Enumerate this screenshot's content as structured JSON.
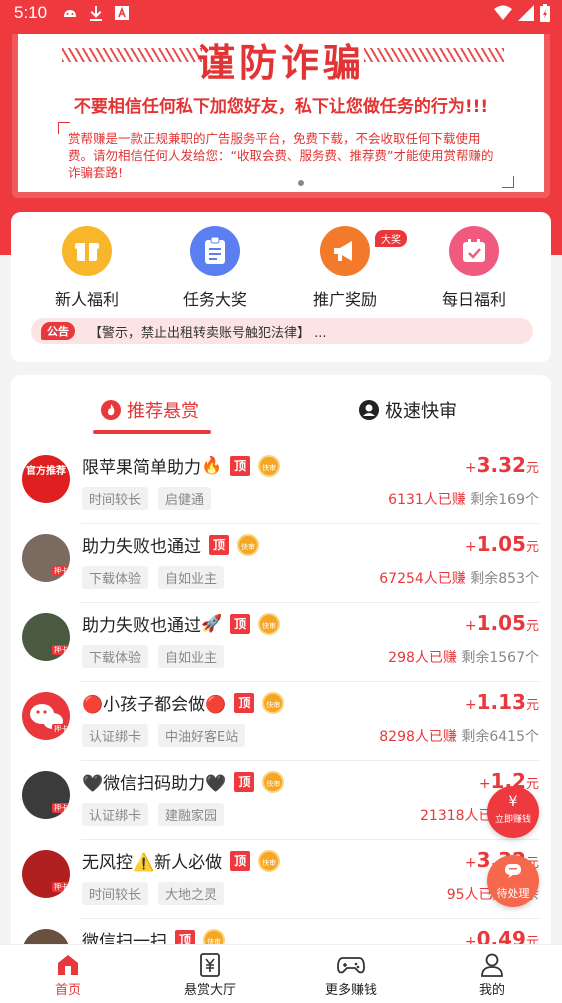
{
  "status_bar": {
    "time": "5:10"
  },
  "banner": {
    "title": "谨防诈骗",
    "subtitle": "不要相信任何私下加您好友，私下让您做任务的行为!!!",
    "body": "赏帮赚是一款正规兼职的广告服务平台，免费下载，不会收取任何下载使用费。请勿相信任何人发给您：“收取会费、服务费、推荐费”才能使用赏帮赚的诈骗套路!"
  },
  "quick_actions": [
    {
      "label": "新人福利",
      "icon": "gift-icon",
      "color": "#f8b72a"
    },
    {
      "label": "任务大奖",
      "icon": "clipboard-icon",
      "color": "#5b7ef0"
    },
    {
      "label": "推广奖励",
      "icon": "megaphone-icon",
      "color": "#f27a2a",
      "badge": "大奖"
    },
    {
      "label": "每日福利",
      "icon": "calendar-icon",
      "color": "#f05a7e"
    }
  ],
  "notice": {
    "tag": "公告",
    "text": "【警示，禁止出租转卖账号触犯法律】 ..."
  },
  "tabs": [
    {
      "label": "推荐悬赏",
      "icon": "flame-icon"
    },
    {
      "label": "极速快审",
      "icon": "user-badge-icon"
    }
  ],
  "task_badges": {
    "top": "顶",
    "fast": "快审"
  },
  "tasks": [
    {
      "title": "限苹果简单助力",
      "emoji": "🔥",
      "tags": [
        "时间较长",
        "启健通"
      ],
      "plus": "+",
      "amount": "3.32",
      "unit": "元",
      "earned": "6131人已赚",
      "remaining": "剩余169个",
      "avatar_text": "官方推荐",
      "avatar_color": "#e02020"
    },
    {
      "title": "助力失败也通过",
      "emoji": "",
      "tags": [
        "下载体验",
        "自如业主"
      ],
      "plus": "+",
      "amount": "1.05",
      "unit": "元",
      "earned": "67254人已赚",
      "remaining": "剩余853个",
      "avatar_text": "",
      "avatar_color": "#7b6a60"
    },
    {
      "title": "助力失败也通过",
      "emoji": "🚀",
      "tags": [
        "下载体验",
        "自如业主"
      ],
      "plus": "+",
      "amount": "1.05",
      "unit": "元",
      "earned": "298人已赚",
      "remaining": "剩余1567个",
      "avatar_text": "",
      "avatar_color": "#4a5a40"
    },
    {
      "title": "🔴小孩子都会做🔴",
      "emoji": "",
      "tags": [
        "认证绑卡",
        "中油好客E站"
      ],
      "plus": "+",
      "amount": "1.13",
      "unit": "元",
      "earned": "8298人已赚",
      "remaining": "剩余6415个",
      "avatar_text": "",
      "avatar_color": "#e8383b"
    },
    {
      "title": "🖤微信扫码助力🖤",
      "emoji": "",
      "tags": [
        "认证绑卡",
        "建融家园"
      ],
      "plus": "+",
      "amount": "1.2",
      "unit": "元",
      "earned": "21318人已赚",
      "remaining": "剩余",
      "avatar_text": "",
      "avatar_color": "#3b3b3b"
    },
    {
      "title": "无风控⚠️新人必做",
      "emoji": "",
      "tags": [
        "时间较长",
        "大地之灵"
      ],
      "plus": "+",
      "amount": "3.32",
      "unit": "元",
      "earned": "95人已赚",
      "remaining": "剩余",
      "avatar_text": "",
      "avatar_color": "#b02020"
    },
    {
      "title": "微信扫一扫",
      "emoji": "",
      "tags": [],
      "plus": "+",
      "amount": "0.49",
      "unit": "元",
      "earned": "",
      "remaining": "",
      "avatar_text": "",
      "avatar_color": "#6a5040"
    }
  ],
  "floating": {
    "earn": {
      "icon": "¥",
      "label": "立即赚钱"
    },
    "pending": {
      "label": "待处理"
    }
  },
  "bottom_nav": [
    {
      "label": "首页",
      "icon": "home-icon",
      "active": true
    },
    {
      "label": "悬赏大厅",
      "icon": "yen-hall-icon",
      "active": false
    },
    {
      "label": "更多赚钱",
      "icon": "gamepad-icon",
      "active": false
    },
    {
      "label": "我的",
      "icon": "user-icon",
      "active": false
    }
  ]
}
